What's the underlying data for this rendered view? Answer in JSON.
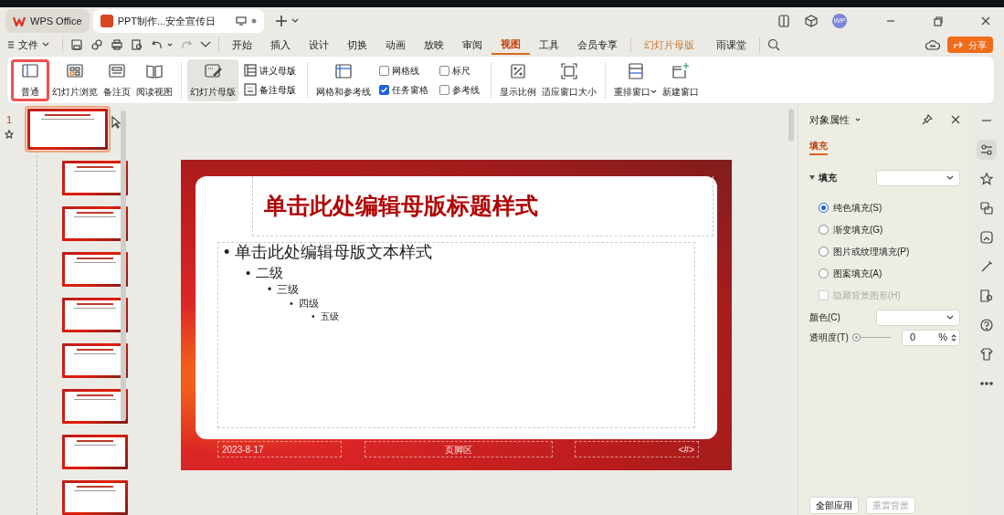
{
  "tabs": [
    {
      "label": "WPS Office",
      "kind": "home",
      "selected": false
    },
    {
      "label": "PPT制作...安全宣传日",
      "kind": "doc",
      "selected": true
    }
  ],
  "avatar": "WP",
  "menu": {
    "file": "文件",
    "items": [
      {
        "label": "开始",
        "kind": "tab",
        "selected": false
      },
      {
        "label": "插入",
        "kind": "tab",
        "selected": false
      },
      {
        "label": "设计",
        "kind": "tab",
        "selected": false
      },
      {
        "label": "切换",
        "kind": "tab",
        "selected": false
      },
      {
        "label": "动画",
        "kind": "tab",
        "selected": false
      },
      {
        "label": "放映",
        "kind": "tab",
        "selected": false
      },
      {
        "label": "审阅",
        "kind": "tab",
        "selected": false
      },
      {
        "label": "视图",
        "kind": "tab",
        "selected": true
      },
      {
        "label": "工具",
        "kind": "tab",
        "selected": false
      },
      {
        "label": "会员专享",
        "kind": "tab",
        "selected": false
      },
      {
        "label": "幻灯片母版",
        "kind": "context",
        "selected": false
      },
      {
        "label": "雨课堂",
        "kind": "tab",
        "selected": false
      }
    ],
    "share": "分享"
  },
  "ribbon": [
    {
      "kind": "large",
      "label": "普通",
      "selected": false,
      "highlighted": true
    },
    {
      "kind": "large",
      "label": "幻灯片浏览",
      "selected": false,
      "highlighted": false
    },
    {
      "kind": "large",
      "label": "备注页",
      "selected": false,
      "highlighted": false
    },
    {
      "kind": "large",
      "label": "阅读视图",
      "selected": false,
      "highlighted": false
    },
    {
      "kind": "divider"
    },
    {
      "kind": "large",
      "label": "幻灯片母版",
      "selected": true,
      "highlighted": false
    },
    {
      "kind": "smallpair",
      "items": [
        {
          "label": "讲义母版"
        },
        {
          "label": "备注母版"
        }
      ]
    },
    {
      "kind": "divider"
    },
    {
      "kind": "large",
      "label": "网格和参考线",
      "selected": false,
      "highlighted": false
    },
    {
      "kind": "checkpair",
      "items": [
        {
          "label": "网格线",
          "checked": false
        },
        {
          "label": "任务窗格",
          "checked": true
        }
      ]
    },
    {
      "kind": "checkpair",
      "items": [
        {
          "label": "标尺",
          "checked": false
        },
        {
          "label": "参考线",
          "checked": false
        }
      ]
    },
    {
      "kind": "divider"
    },
    {
      "kind": "large",
      "label": "显示比例",
      "selected": false,
      "highlighted": false
    },
    {
      "kind": "large",
      "label": "适应窗口大小",
      "selected": false,
      "highlighted": false
    },
    {
      "kind": "divider"
    },
    {
      "kind": "large",
      "label": "重排窗口",
      "selected": false,
      "highlighted": false,
      "caret": true
    },
    {
      "kind": "large",
      "label": "新建窗口",
      "selected": false,
      "highlighted": false
    }
  ],
  "thumbnails": [
    {
      "number": "1",
      "selected": true
    },
    {
      "selected": false
    },
    {
      "selected": false
    },
    {
      "selected": false
    },
    {
      "selected": false
    },
    {
      "selected": false
    },
    {
      "selected": false
    },
    {
      "selected": false
    },
    {
      "selected": false
    }
  ],
  "slide": {
    "title": "单击此处编辑母版标题样式",
    "body": [
      {
        "bullet": "•",
        "text": "单击此处编辑母版文本样式",
        "children": [
          {
            "bullet": "•",
            "text": "二级",
            "children": [
              {
                "bullet": "•",
                "text": "三级",
                "children": [
                  {
                    "bullet": "•",
                    "text": "四级",
                    "children": [
                      {
                        "bullet": "•",
                        "text": "五级"
                      }
                    ]
                  }
                ]
              }
            ]
          }
        ]
      }
    ],
    "footer": {
      "date": "2023-8-17",
      "center": "页脚区",
      "number": "<#>"
    }
  },
  "panel": {
    "title": "对象属性",
    "tab": "填充",
    "section": "填充",
    "options": [
      {
        "label": "纯色填充(S)",
        "selected": true
      },
      {
        "label": "渐变填充(G)",
        "selected": false
      },
      {
        "label": "图片或纹理填充(P)",
        "selected": false
      },
      {
        "label": "图案填充(A)",
        "selected": false
      }
    ],
    "hide_graphics": {
      "label": "隐藏背景图形(H)",
      "checked": false,
      "disabled": true
    },
    "color_label": "颜色(C)",
    "transparency": {
      "label": "透明度(T)",
      "level": 0,
      "value": "0",
      "unit": "%"
    },
    "buttons": [
      "全部应用",
      "重置背景"
    ]
  }
}
